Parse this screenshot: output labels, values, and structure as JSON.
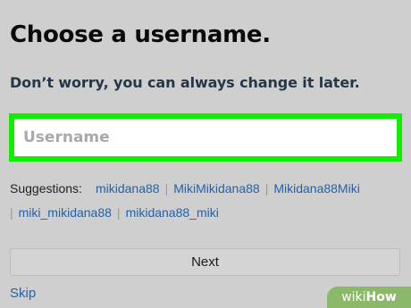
{
  "page": {
    "title": "Choose a username.",
    "subtitle": "Don’t worry, you can always change it later."
  },
  "username_field": {
    "placeholder": "Username",
    "value": "",
    "highlight_color": "#11ee00"
  },
  "suggestions": {
    "label": "Suggestions:",
    "items": [
      "mikidana88",
      "MikiMikidana88",
      "Mikidana88Miki",
      "miki_mikidana88",
      "mikidana88_miki"
    ]
  },
  "actions": {
    "next_label": "Next",
    "skip_label": "Skip"
  },
  "watermark": {
    "wiki": "wiki",
    "how": "How",
    "color": "#8cb86a"
  },
  "colors": {
    "background": "#cfcfcf",
    "link": "#2461a7",
    "subtitle": "#26374a"
  }
}
